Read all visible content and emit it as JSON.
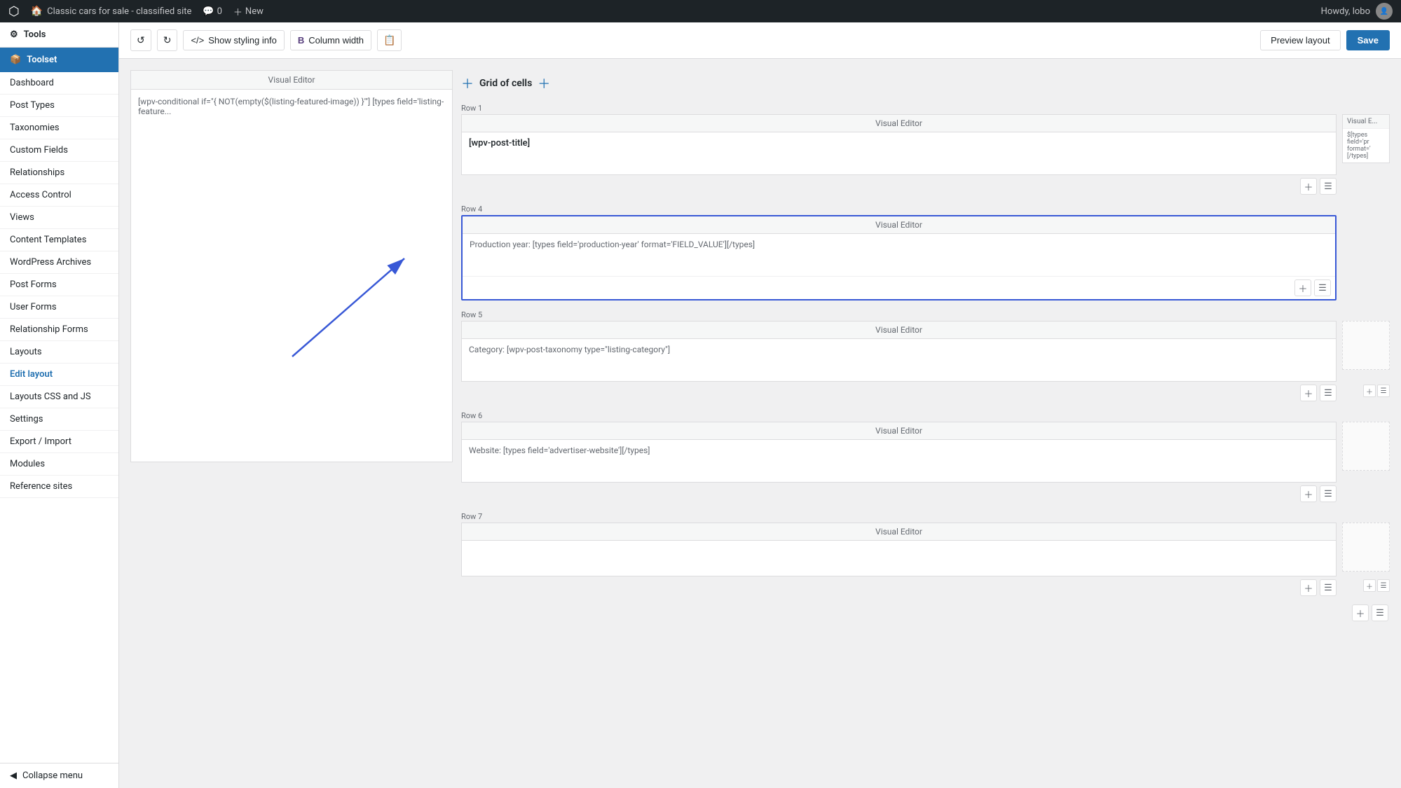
{
  "adminBar": {
    "siteName": "Classic cars for sale - classified site",
    "commentsLabel": "0",
    "newLabel": "New",
    "userGreeting": "Howdy, lobo"
  },
  "sidebar": {
    "toolsLabel": "Tools",
    "toolsetLabel": "Toolset",
    "navItems": [
      {
        "id": "dashboard",
        "label": "Dashboard"
      },
      {
        "id": "post-types",
        "label": "Post Types"
      },
      {
        "id": "taxonomies",
        "label": "Taxonomies"
      },
      {
        "id": "custom-fields",
        "label": "Custom Fields"
      },
      {
        "id": "relationships",
        "label": "Relationships"
      },
      {
        "id": "access-control",
        "label": "Access Control"
      },
      {
        "id": "views",
        "label": "Views"
      },
      {
        "id": "content-templates",
        "label": "Content Templates"
      },
      {
        "id": "wordpress-archives",
        "label": "WordPress Archives"
      },
      {
        "id": "post-forms",
        "label": "Post Forms"
      },
      {
        "id": "user-forms",
        "label": "User Forms"
      },
      {
        "id": "relationship-forms",
        "label": "Relationship Forms"
      },
      {
        "id": "layouts",
        "label": "Layouts"
      },
      {
        "id": "edit-layout",
        "label": "Edit layout",
        "active": true
      },
      {
        "id": "layouts-css-js",
        "label": "Layouts CSS and JS"
      },
      {
        "id": "settings",
        "label": "Settings"
      },
      {
        "id": "export-import",
        "label": "Export / Import"
      },
      {
        "id": "modules",
        "label": "Modules"
      },
      {
        "id": "reference-sites",
        "label": "Reference sites"
      }
    ],
    "collapseLabel": "Collapse menu"
  },
  "toolbar": {
    "undoLabel": "↺",
    "redoLabel": "↻",
    "showStylingLabel": "Show styling info",
    "columnWidthLabel": "Column width",
    "previewLabel": "Preview layout",
    "saveLabel": "Save"
  },
  "canvas": {
    "leftEditor": {
      "header": "Visual Editor",
      "content": "[wpv-conditional if=\"{ NOT(empty($(listing-featured-image)) }'\"] [types field='listing-feature..."
    },
    "gridTitle": "Grid of cells",
    "row1": {
      "label": "Row 1",
      "mainCell": {
        "header": "Visual Editor",
        "content": "[wpv-post-title]"
      },
      "sideCell": {
        "header": "Visual E...",
        "lines": [
          "$[types",
          "field='pr",
          "format='",
          "[/types]"
        ]
      }
    },
    "row4": {
      "label": "Row 4",
      "mainCell": {
        "header": "Visual Editor",
        "content": "Production year: [types field='production-year' format='FIELD_VALUE'][/types]"
      },
      "highlighted": true
    },
    "row5": {
      "label": "Row 5",
      "mainCell": {
        "header": "Visual Editor",
        "content": "Category: [wpv-post-taxonomy type=\"listing-category\"]"
      }
    },
    "row6": {
      "label": "Row 6",
      "mainCell": {
        "header": "Visual Editor",
        "content": "Website: [types field='advertiser-website'][/types]"
      }
    },
    "row7": {
      "label": "Row 7",
      "mainCell": {
        "header": "Visual Editor",
        "content": ""
      }
    }
  }
}
